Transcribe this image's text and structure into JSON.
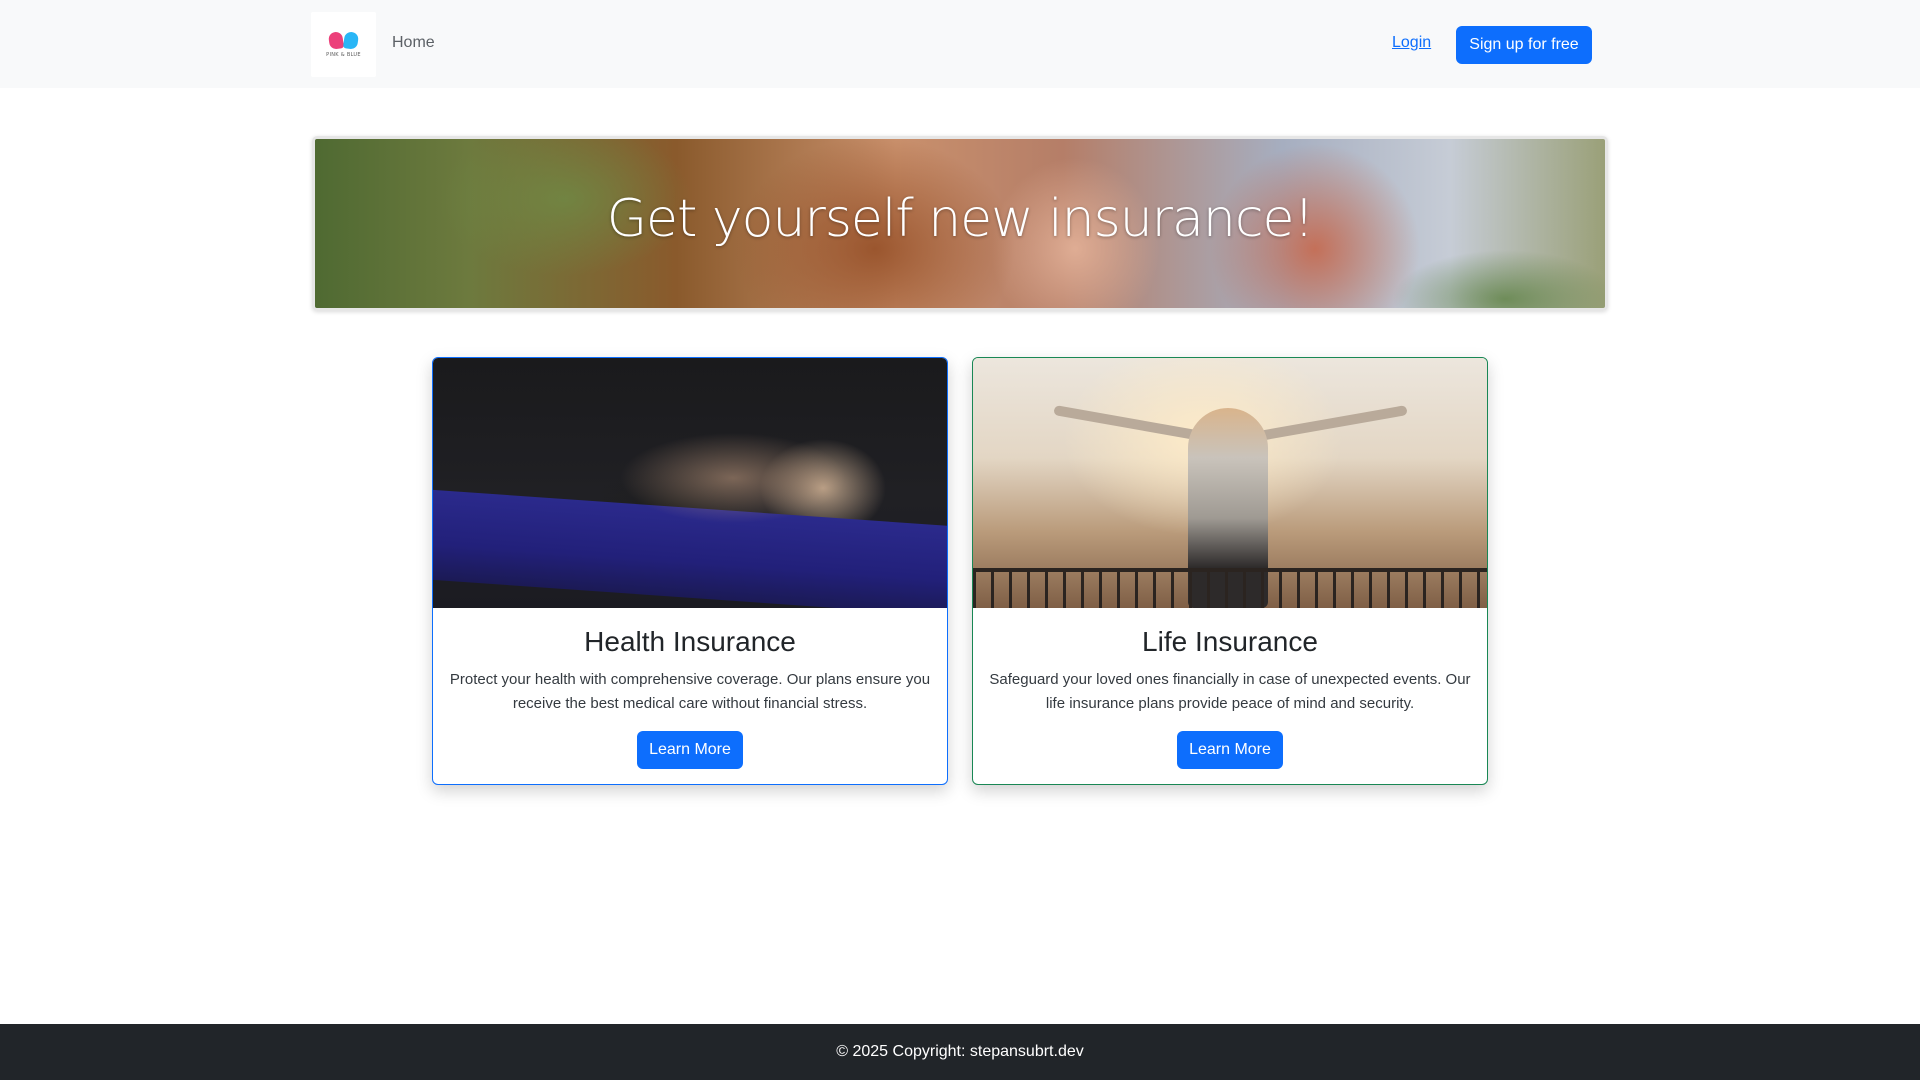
{
  "navbar": {
    "logo_text": "PINK & BLUE",
    "home_label": "Home",
    "login_label": "Login",
    "signup_label": "Sign up for free"
  },
  "hero": {
    "title": "Get yourself new insurance!"
  },
  "cards": [
    {
      "title": "Health Insurance",
      "text": "Protect your health with comprehensive coverage. Our plans ensure you receive the best medical care without financial stress.",
      "button_label": "Learn More",
      "border_color": "#0d6efd"
    },
    {
      "title": "Life Insurance",
      "text": "Safeguard your loved ones financially in case of unexpected events. Our life insurance plans provide peace of mind and security.",
      "button_label": "Learn More",
      "border_color": "#198754"
    }
  ],
  "footer": {
    "copyright": "© 2025 Copyright: stepansubrt.dev"
  },
  "colors": {
    "primary": "#0d6efd",
    "navbar_bg": "#f8f9fa",
    "footer_bg": "#212529",
    "life_card_border": "#198754"
  }
}
